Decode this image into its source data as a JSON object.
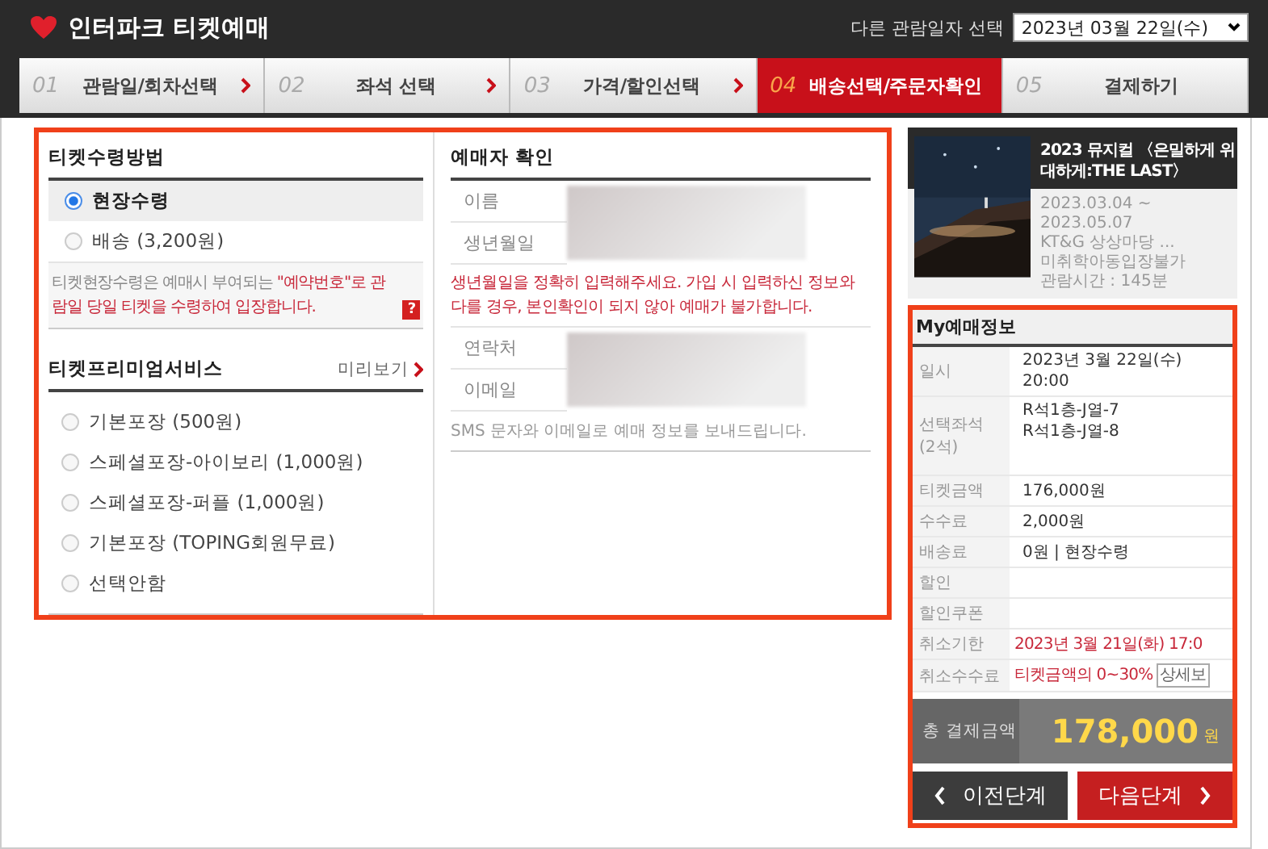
{
  "header": {
    "title": "인터파크 티켓예매",
    "date_label": "다른 관람일자 선택",
    "date_value": "2023년 03월 22일(수)"
  },
  "steps": [
    {
      "number": "01",
      "label": "관람일/회차선택",
      "selected": false
    },
    {
      "number": "02",
      "label": "좌석 선택",
      "selected": false
    },
    {
      "number": "03",
      "label": "가격/할인선택",
      "selected": false
    },
    {
      "number": "04",
      "label": "배송선택/주문자확인",
      "selected": true
    },
    {
      "number": "05",
      "label": "결제하기",
      "selected": false
    }
  ],
  "delivery": {
    "title": "티켓수령방법",
    "options": [
      {
        "label": "현장수령",
        "selected": true
      },
      {
        "label": "배송 (3,200원)",
        "selected": false
      }
    ],
    "notice": {
      "text": "티켓현장수령은 예매시 부여되는 ",
      "highlight": "\"예약번호\"로 관람일 당일 티켓을 수령하여 입장합니다."
    },
    "help": "?"
  },
  "premium": {
    "title": "티켓프리미엄서비스",
    "preview": "미리보기",
    "options": [
      {
        "label": "기본포장 (500원)",
        "selected": false
      },
      {
        "label": "스페셜포장-아이보리 (1,000원)",
        "selected": false
      },
      {
        "label": "스페셜포장-퍼플 (1,000원)",
        "selected": false
      },
      {
        "label": "기본포장 (TOPING회원무료)",
        "selected": false
      },
      {
        "label": "선택안함",
        "selected": false
      }
    ]
  },
  "booker": {
    "title": "예매자 확인",
    "group1": [
      "이름",
      "생년월일"
    ],
    "warning": "생년월일을 정확히 입력해주세요. 가입 시 입력하신 정보와 다를 경우, 본인확인이 되지 않아 예매가 불가합니다.",
    "group2": [
      "연락처",
      "이메일"
    ],
    "note": "SMS 문자와 이메일로 예매 정보를 보내드립니다."
  },
  "show": {
    "title": "2023 뮤지컬 〈은밀하게 위대하게:THE LAST〉",
    "info": [
      "2023.03.04 ~",
      "2023.05.07",
      "KT&G 상상마당 ...",
      "미취학아동입장불가",
      "관람시간 : 145분"
    ]
  },
  "my_booking": {
    "title": "My예매정보",
    "rows": [
      {
        "label": "일시",
        "values": [
          "2023년 3월 22일(수)",
          "20:00"
        ]
      },
      {
        "label": "선택좌석 (2석)",
        "values": [
          "R석1층-J열-7",
          "R석1층-J열-8"
        ],
        "kind": "tall"
      },
      {
        "label": "티켓금액",
        "values": [
          "176,000원"
        ]
      },
      {
        "label": "수수료",
        "values": [
          "2,000원"
        ]
      },
      {
        "label": "배송료",
        "values": [
          "0원 | 현장수령"
        ]
      },
      {
        "label": "할인"
      },
      {
        "label": "할인쿠폰"
      },
      {
        "label": "취소기한",
        "values": [
          "2023년 3월 21일(화) 17:0"
        ],
        "kind": "alert"
      },
      {
        "label": "취소수수료",
        "values": [
          "티켓금액의 0~30%"
        ],
        "kind": "alert",
        "button": "상세보"
      }
    ],
    "total_label": "총 결제금액",
    "total": "178,000",
    "unit": "원"
  },
  "buttons": {
    "prev": "이전단계",
    "next": "다음단계"
  }
}
